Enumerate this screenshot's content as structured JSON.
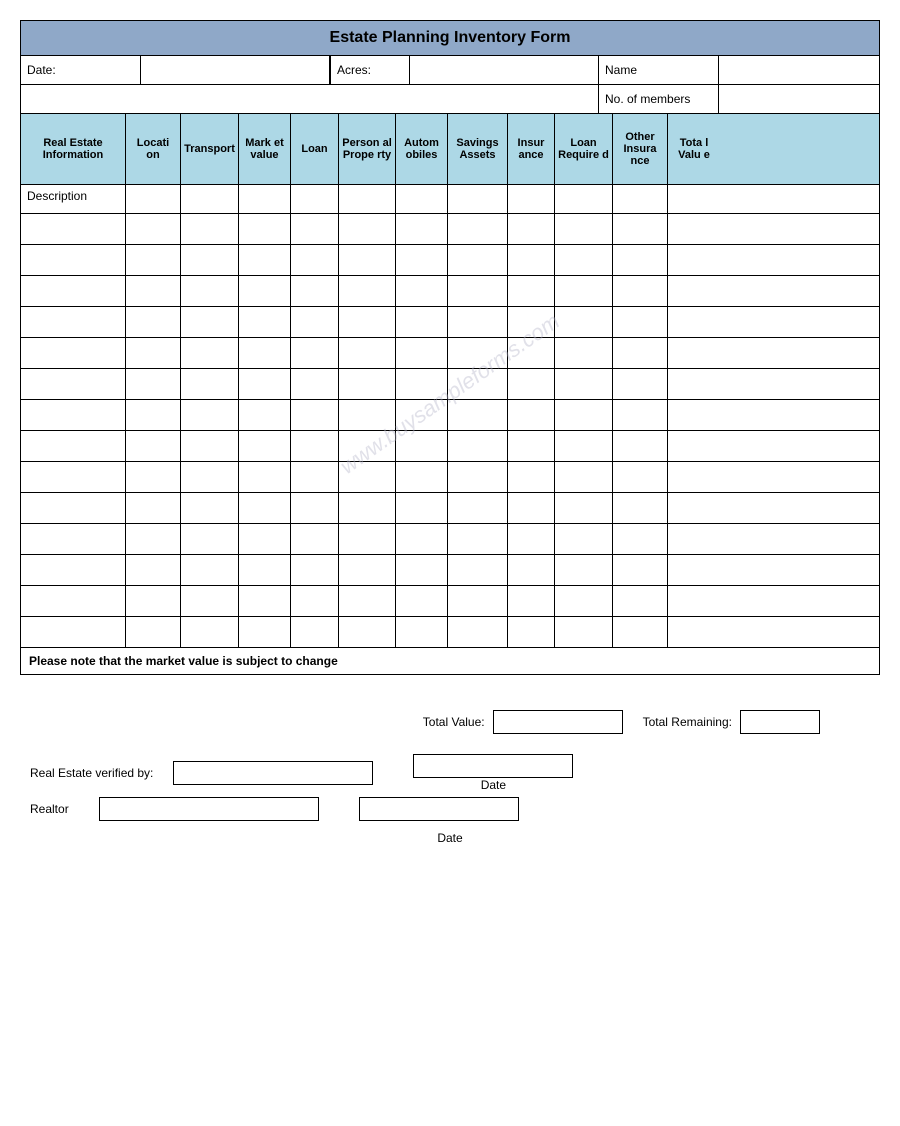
{
  "form": {
    "title": "Estate Planning Inventory Form",
    "meta": {
      "date_label": "Date:",
      "acres_label": "Acres:",
      "name_label": "Name",
      "no_of_members_label": "No. of members"
    },
    "columns": [
      {
        "id": "real-estate",
        "label": "Real Estate Information"
      },
      {
        "id": "location",
        "label": "Location"
      },
      {
        "id": "transport",
        "label": "Transport"
      },
      {
        "id": "market",
        "label": "Market value"
      },
      {
        "id": "loan",
        "label": "Loan"
      },
      {
        "id": "personal",
        "label": "Personal Property"
      },
      {
        "id": "autos",
        "label": "Automobiles"
      },
      {
        "id": "savings",
        "label": "Savings Assets"
      },
      {
        "id": "insurance",
        "label": "Insurance"
      },
      {
        "id": "loan-req",
        "label": "Loan Required"
      },
      {
        "id": "other",
        "label": "Other Insurance"
      },
      {
        "id": "total",
        "label": "Total Value"
      }
    ],
    "description_label": "Description",
    "data_rows": 14,
    "notice": "Please note that the market value is subject to change",
    "watermark": "www.buysampleforms.com"
  },
  "footer": {
    "total_value_label": "Total Value:",
    "total_remaining_label": "Total Remaining:",
    "real_estate_verified_label": "Real Estate verified by:",
    "date_label": "Date",
    "realtor_label": "Realtor",
    "date_bottom_label": "Date"
  }
}
